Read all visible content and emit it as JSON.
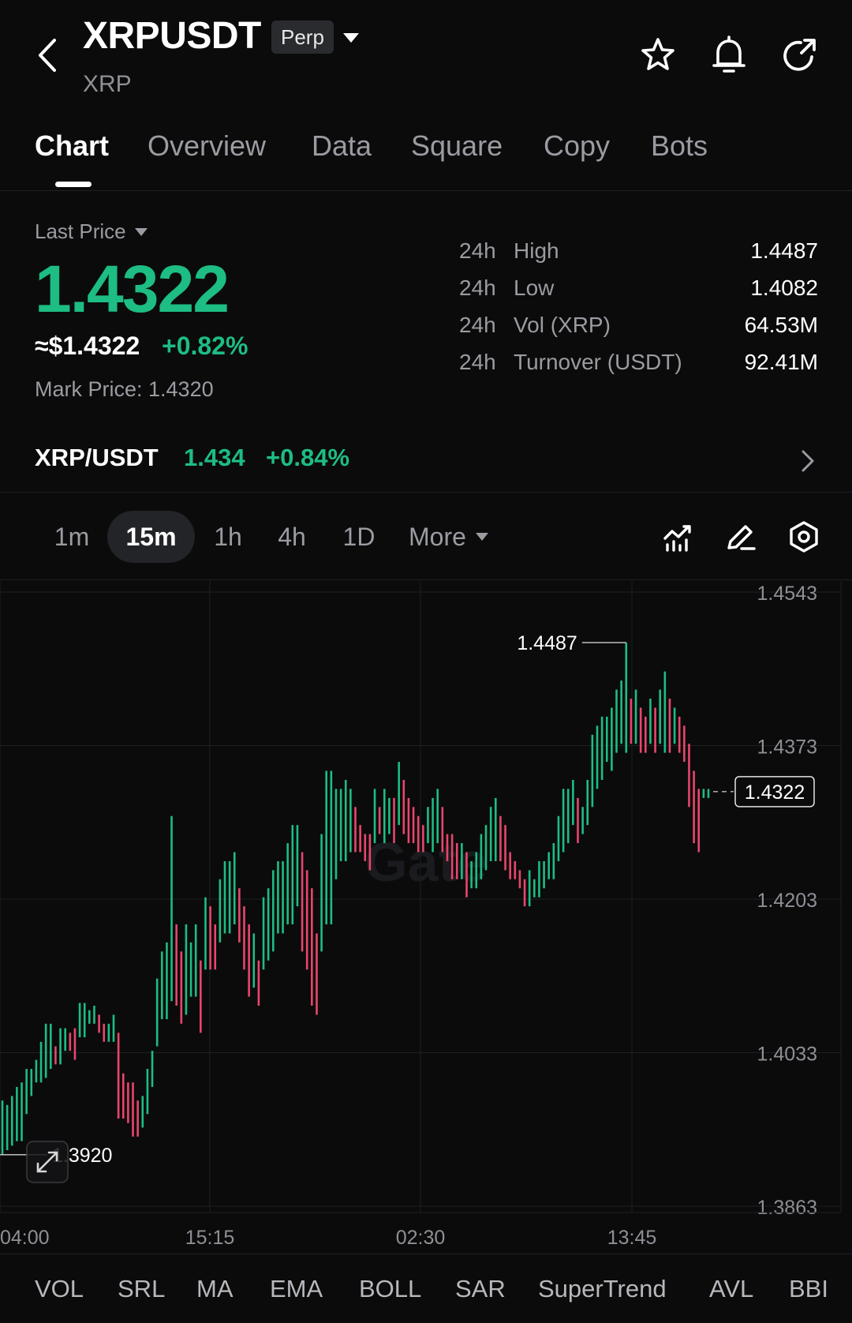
{
  "header": {
    "symbol": "XRPUSDT",
    "contract_type": "Perp",
    "base_name": "XRP",
    "icons": [
      "back-arrow-icon",
      "chevron-down-icon",
      "star-icon",
      "bell-icon",
      "share-icon"
    ]
  },
  "tabs": [
    {
      "label": "Chart",
      "active": true
    },
    {
      "label": "Overview",
      "active": false
    },
    {
      "label": "Data",
      "active": false
    },
    {
      "label": "Square",
      "active": false
    },
    {
      "label": "Copy",
      "active": false
    },
    {
      "label": "Bots",
      "active": false
    }
  ],
  "price_panel": {
    "last_price_label": "Last Price",
    "last_price": "1.4322",
    "fiat_price": "≈$1.4322",
    "change_pct": "+0.82%",
    "mark_price": "Mark Price: 1.4320",
    "stats": [
      {
        "period": "24h",
        "label": "High",
        "value": "1.4487"
      },
      {
        "period": "24h",
        "label": "Low",
        "value": "1.4082"
      },
      {
        "period": "24h",
        "label": "Vol (XRP)",
        "value": "64.53M"
      },
      {
        "period": "24h",
        "label": "Turnover (USDT)",
        "value": "92.41M"
      }
    ]
  },
  "spot": {
    "pair": "XRP/USDT",
    "price": "1.434",
    "change": "+0.84%"
  },
  "intervals": {
    "items": [
      "1m",
      "15m",
      "1h",
      "4h",
      "1D"
    ],
    "selected": "15m",
    "more_label": "More",
    "tools": [
      "indicator-icon",
      "draw-pen-icon",
      "settings-hex-icon"
    ]
  },
  "colors": {
    "up": "#1dbd83",
    "down": "#e8466b",
    "background": "#0b0b0c",
    "grid": "#1e1f22",
    "axis_text": "#8e9095"
  },
  "chart_data": {
    "type": "candlestick",
    "interval": "15m",
    "y_ticks": [
      "1.4543",
      "1.4373",
      "1.4203",
      "1.4033",
      "1.3863"
    ],
    "ylim": [
      1.3863,
      1.4543
    ],
    "x_ticks": [
      "04:00",
      "15:15",
      "02:30",
      "13:45"
    ],
    "high_marker": "1.4487",
    "low_marker": "1.3920",
    "current_price_label": "1.4322",
    "watermark": "Gate",
    "candles_hl": [
      [
        1.392,
        1.398
      ],
      [
        1.3925,
        1.3975
      ],
      [
        1.393,
        1.3985
      ],
      [
        1.3935,
        1.3995
      ],
      [
        1.3935,
        1.4
      ],
      [
        1.3965,
        1.4015
      ],
      [
        1.3985,
        1.4015
      ],
      [
        1.4,
        1.4025
      ],
      [
        1.4,
        1.4045
      ],
      [
        1.4005,
        1.4065
      ],
      [
        1.4015,
        1.4065
      ],
      [
        1.402,
        1.404
      ],
      [
        1.402,
        1.406
      ],
      [
        1.4035,
        1.406
      ],
      [
        1.4035,
        1.4055
      ],
      [
        1.4025,
        1.406
      ],
      [
        1.405,
        1.4088
      ],
      [
        1.405,
        1.4088
      ],
      [
        1.4065,
        1.408
      ],
      [
        1.4065,
        1.4085
      ],
      [
        1.4055,
        1.4075
      ],
      [
        1.4045,
        1.4065
      ],
      [
        1.4045,
        1.4065
      ],
      [
        1.4045,
        1.4075
      ],
      [
        1.396,
        1.4055
      ],
      [
        1.396,
        1.401
      ],
      [
        1.3955,
        1.4
      ],
      [
        1.394,
        1.4
      ],
      [
        1.394,
        1.398
      ],
      [
        1.395,
        1.3985
      ],
      [
        1.3965,
        1.4015
      ],
      [
        1.3995,
        1.4035
      ],
      [
        1.404,
        1.4115
      ],
      [
        1.407,
        1.4145
      ],
      [
        1.407,
        1.4155
      ],
      [
        1.409,
        1.4295
      ],
      [
        1.4085,
        1.4175
      ],
      [
        1.4065,
        1.4145
      ],
      [
        1.4075,
        1.4175
      ],
      [
        1.4095,
        1.4155
      ],
      [
        1.4095,
        1.4175
      ],
      [
        1.4055,
        1.4135
      ],
      [
        1.4125,
        1.4205
      ],
      [
        1.4125,
        1.4195
      ],
      [
        1.4125,
        1.4175
      ],
      [
        1.4155,
        1.4225
      ],
      [
        1.4165,
        1.4245
      ],
      [
        1.4165,
        1.4245
      ],
      [
        1.4175,
        1.4255
      ],
      [
        1.4155,
        1.4215
      ],
      [
        1.4125,
        1.4195
      ],
      [
        1.4095,
        1.4175
      ],
      [
        1.4105,
        1.4165
      ],
      [
        1.4085,
        1.4135
      ],
      [
        1.4125,
        1.4205
      ],
      [
        1.4135,
        1.4215
      ],
      [
        1.4145,
        1.4235
      ],
      [
        1.4165,
        1.4245
      ],
      [
        1.4165,
        1.4245
      ],
      [
        1.4175,
        1.4265
      ],
      [
        1.4175,
        1.4285
      ],
      [
        1.4195,
        1.4285
      ],
      [
        1.4145,
        1.4255
      ],
      [
        1.4125,
        1.4235
      ],
      [
        1.4085,
        1.4215
      ],
      [
        1.4075,
        1.4165
      ],
      [
        1.4145,
        1.4275
      ],
      [
        1.4175,
        1.4345
      ],
      [
        1.4175,
        1.4345
      ],
      [
        1.4225,
        1.4325
      ],
      [
        1.4245,
        1.4325
      ],
      [
        1.4245,
        1.4335
      ],
      [
        1.4255,
        1.4325
      ],
      [
        1.4255,
        1.4305
      ],
      [
        1.4255,
        1.4285
      ],
      [
        1.4245,
        1.4275
      ],
      [
        1.4235,
        1.4275
      ],
      [
        1.4265,
        1.4325
      ],
      [
        1.4275,
        1.4305
      ],
      [
        1.4265,
        1.4325
      ],
      [
        1.4275,
        1.4315
      ],
      [
        1.4265,
        1.4315
      ],
      [
        1.4285,
        1.4355
      ],
      [
        1.4275,
        1.4335
      ],
      [
        1.4265,
        1.4315
      ],
      [
        1.4265,
        1.4305
      ],
      [
        1.4255,
        1.4295
      ],
      [
        1.4255,
        1.4285
      ],
      [
        1.4265,
        1.4305
      ],
      [
        1.4255,
        1.4315
      ],
      [
        1.4265,
        1.4325
      ],
      [
        1.4255,
        1.4305
      ],
      [
        1.4245,
        1.4275
      ],
      [
        1.4225,
        1.4275
      ],
      [
        1.4225,
        1.4265
      ],
      [
        1.4225,
        1.4265
      ],
      [
        1.4205,
        1.4255
      ],
      [
        1.4215,
        1.4245
      ],
      [
        1.4215,
        1.4255
      ],
      [
        1.4225,
        1.4275
      ],
      [
        1.4235,
        1.4285
      ],
      [
        1.4245,
        1.4305
      ],
      [
        1.4245,
        1.4315
      ],
      [
        1.4245,
        1.4295
      ],
      [
        1.4235,
        1.4285
      ],
      [
        1.4225,
        1.4255
      ],
      [
        1.4225,
        1.4245
      ],
      [
        1.4215,
        1.4235
      ],
      [
        1.4195,
        1.4225
      ],
      [
        1.4195,
        1.4235
      ],
      [
        1.4205,
        1.4225
      ],
      [
        1.4205,
        1.4245
      ],
      [
        1.4215,
        1.4245
      ],
      [
        1.4225,
        1.4255
      ],
      [
        1.4225,
        1.4265
      ],
      [
        1.4245,
        1.4295
      ],
      [
        1.4255,
        1.4325
      ],
      [
        1.4265,
        1.4325
      ],
      [
        1.4285,
        1.4335
      ],
      [
        1.4265,
        1.4315
      ],
      [
        1.4275,
        1.4305
      ],
      [
        1.4285,
        1.4335
      ],
      [
        1.4305,
        1.4385
      ],
      [
        1.4325,
        1.4395
      ],
      [
        1.4335,
        1.4405
      ],
      [
        1.4355,
        1.4405
      ],
      [
        1.4345,
        1.4415
      ],
      [
        1.4365,
        1.4435
      ],
      [
        1.4375,
        1.4445
      ],
      [
        1.4365,
        1.4487
      ],
      [
        1.4375,
        1.4425
      ],
      [
        1.4375,
        1.4435
      ],
      [
        1.4365,
        1.4415
      ],
      [
        1.4365,
        1.4405
      ],
      [
        1.4375,
        1.4425
      ],
      [
        1.4365,
        1.4415
      ],
      [
        1.4375,
        1.4435
      ],
      [
        1.4365,
        1.4455
      ],
      [
        1.4365,
        1.4425
      ],
      [
        1.4375,
        1.4415
      ],
      [
        1.4365,
        1.4405
      ],
      [
        1.4355,
        1.4395
      ],
      [
        1.4305,
        1.4375
      ],
      [
        1.4265,
        1.4345
      ],
      [
        1.4255,
        1.4325
      ],
      [
        1.4315,
        1.4325
      ],
      [
        1.4315,
        1.4325
      ]
    ]
  },
  "indicators": [
    "VOL",
    "SRL",
    "MA",
    "EMA",
    "BOLL",
    "SAR",
    "SuperTrend",
    "AVL",
    "BBI"
  ]
}
